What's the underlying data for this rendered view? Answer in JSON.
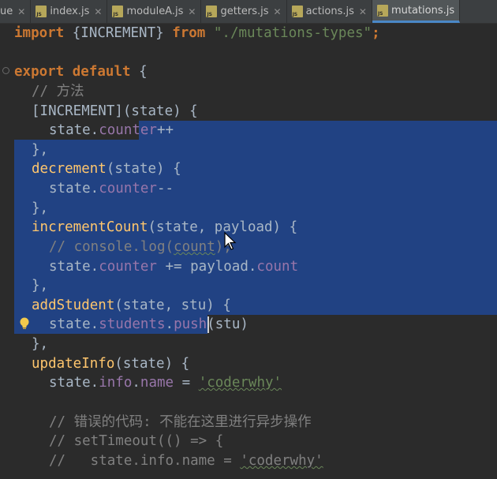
{
  "tabs": [
    {
      "label": "ue",
      "active": false,
      "icon": false
    },
    {
      "label": "index.js",
      "active": false,
      "icon": true
    },
    {
      "label": "moduleA.js",
      "active": false,
      "icon": true
    },
    {
      "label": "getters.js",
      "active": false,
      "icon": true
    },
    {
      "label": "actions.js",
      "active": false,
      "icon": true
    },
    {
      "label": "mutations.js",
      "active": true,
      "icon": true
    }
  ],
  "code": {
    "l1": {
      "kw1": "import",
      "t1": " {INCREMENT} ",
      "kw2": "from",
      "t2": " ",
      "s1": "\"./mutations-types\"",
      "t3": ";"
    },
    "l3": {
      "kw1": "export",
      "t1": " ",
      "kw2": "default",
      "t2": " {"
    },
    "l4": {
      "c": "// 方法"
    },
    "l5": {
      "t": "[INCREMENT](state) {"
    },
    "l6": {
      "t1": "state.",
      "p1": "counter",
      "t2": "++"
    },
    "l7": {
      "t": "},"
    },
    "l8": {
      "f": "decrement",
      "t": "(state) {"
    },
    "l9": {
      "t1": "state.",
      "p1": "counter",
      "t2": "--"
    },
    "l10": {
      "t": "},"
    },
    "l11": {
      "f": "incrementCount",
      "t": "(state, payload) {"
    },
    "l12": {
      "c1": "// console.log(",
      "c2": "count",
      "c3": ");"
    },
    "l13": {
      "t1": "state.",
      "p1": "counter",
      "t2": " += payload.",
      "p2": "count"
    },
    "l14": {
      "t": "},"
    },
    "l15": {
      "f": "addStudent",
      "t": "(state, stu) {"
    },
    "l16": {
      "t1": "state.",
      "p1": "students",
      "t2": ".",
      "p2": "push",
      "t3": "(stu)"
    },
    "l17": {
      "t": "},"
    },
    "l18": {
      "f": "updateInfo",
      "t": "(state) {"
    },
    "l19": {
      "t1": "state.",
      "p1": "info",
      "t2": ".",
      "p2": "name",
      "t3": " = ",
      "s1": "'coderwhy'"
    },
    "l21": {
      "c": "// 错误的代码: 不能在这里进行异步操作"
    },
    "l22": {
      "c": "// setTimeout(() => {"
    },
    "l23": {
      "c1": "//   state.info.name = ",
      "c2": "'coderwhy'"
    }
  },
  "colors": {
    "background": "#2b2b2b",
    "selection": "#214283",
    "keyword": "#cc7832",
    "string": "#6a8759",
    "comment": "#808080",
    "function": "#ffc66d",
    "property": "#9876aa",
    "text": "#a9b7c6"
  },
  "icons": [
    "js-file-icon",
    "close-icon",
    "fold-icon",
    "lightbulb-icon",
    "mouse-cursor-icon"
  ]
}
